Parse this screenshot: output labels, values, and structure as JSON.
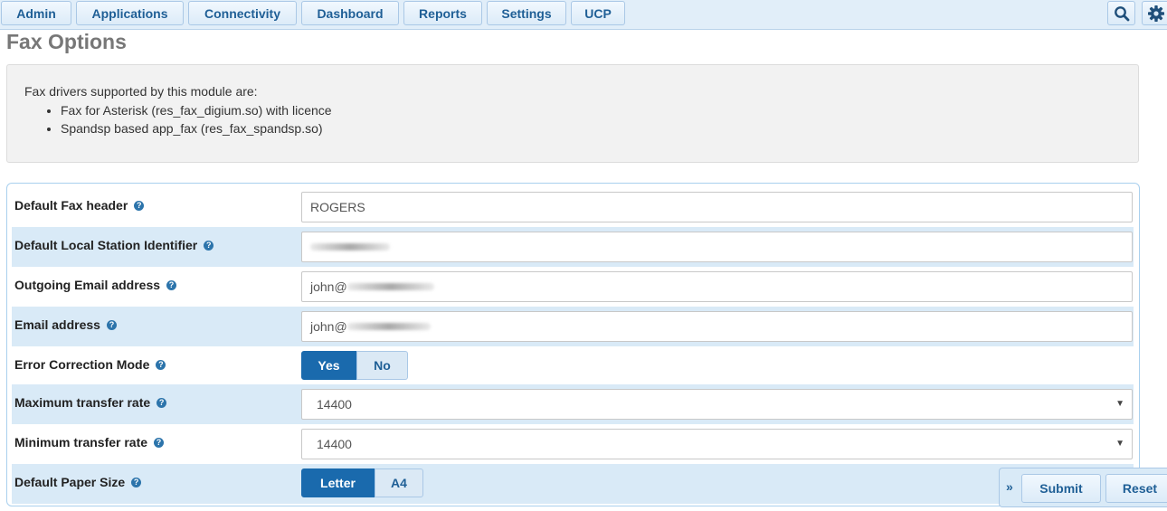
{
  "nav": {
    "items": [
      "Admin",
      "Applications",
      "Connectivity",
      "Dashboard",
      "Reports",
      "Settings",
      "UCP"
    ],
    "search_icon": "search-icon",
    "settings_icon": "gear-icon"
  },
  "page": {
    "title": "Fax Options"
  },
  "info": {
    "intro": "Fax drivers supported by this module are:",
    "drivers": [
      "Fax for Asterisk (res_fax_digium.so) with licence",
      "Spandsp based app_fax (res_fax_spandsp.so)"
    ]
  },
  "form": {
    "default_fax_header": {
      "label": "Default Fax header",
      "value": "ROGERS"
    },
    "local_station_id": {
      "label": "Default Local Station Identifier",
      "value": ""
    },
    "outgoing_email": {
      "label": "Outgoing Email address",
      "value": "john@"
    },
    "email": {
      "label": "Email address",
      "value": "john@"
    },
    "ecm": {
      "label": "Error Correction Mode",
      "options": [
        "Yes",
        "No"
      ],
      "selected": "Yes"
    },
    "max_rate": {
      "label": "Maximum transfer rate",
      "value": "14400"
    },
    "min_rate": {
      "label": "Minimum transfer rate",
      "value": "14400"
    },
    "paper_size": {
      "label": "Default Paper Size",
      "options": [
        "Letter",
        "A4"
      ],
      "selected": "Letter"
    },
    "help_glyph": "?"
  },
  "actions": {
    "collapse": "»",
    "submit": "Submit",
    "reset": "Reset"
  },
  "colors": {
    "accent": "#1a6aad",
    "nav_text": "#1f5f96",
    "row_alt": "#d9eaf7"
  }
}
